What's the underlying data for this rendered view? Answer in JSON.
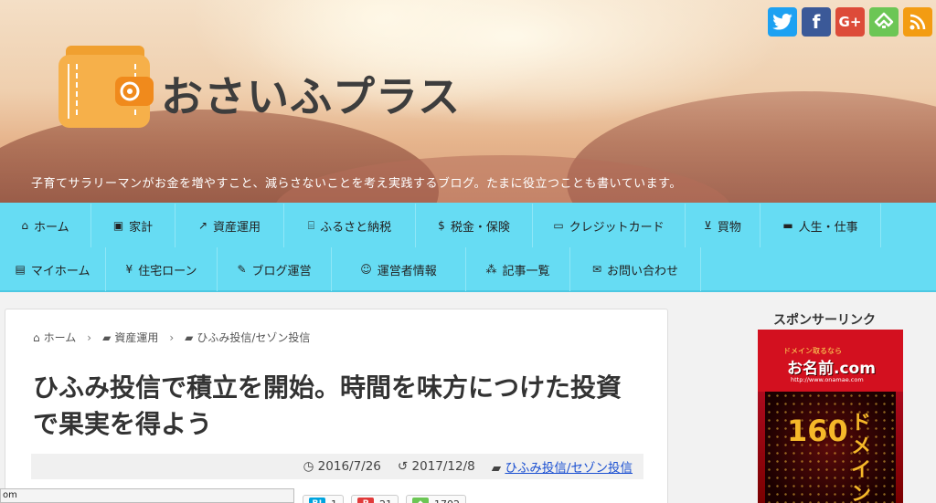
{
  "site": {
    "title": "おさいふプラス",
    "tagline": "子育てサラリーマンがお金を増やすこと、減らさないことを考え実践するブログ。たまに役立つことも書いています。"
  },
  "social": [
    {
      "name": "twitter-icon",
      "glyph": "t"
    },
    {
      "name": "facebook-icon",
      "glyph": "f"
    },
    {
      "name": "google-plus-icon",
      "glyph": "G+"
    },
    {
      "name": "feedly-icon",
      "glyph": "f"
    },
    {
      "name": "rss-icon",
      "glyph": "≋"
    }
  ],
  "nav": {
    "row1": [
      {
        "icon": "⌂",
        "icon_name": "home-icon",
        "label": "ホーム"
      },
      {
        "icon": "▣",
        "icon_name": "money-icon",
        "label": "家計"
      },
      {
        "icon": "↗",
        "icon_name": "chart-icon",
        "label": "資産運用"
      },
      {
        "icon": "⌸",
        "icon_name": "institution-icon",
        "label": "ふるさと納税"
      },
      {
        "icon": "$",
        "icon_name": "dollar-icon",
        "label": "税金・保険"
      },
      {
        "icon": "▭",
        "icon_name": "credit-card-icon",
        "label": "クレジットカード"
      },
      {
        "icon": "⊻",
        "icon_name": "cart-icon",
        "label": "買物"
      },
      {
        "icon": "▬",
        "icon_name": "briefcase-icon",
        "label": "人生・仕事"
      }
    ],
    "row2": [
      {
        "icon": "▤",
        "icon_name": "building-icon",
        "label": "マイホーム"
      },
      {
        "icon": "¥",
        "icon_name": "yen-icon",
        "label": "住宅ローン"
      },
      {
        "icon": "✎",
        "icon_name": "edit-icon",
        "label": "ブログ運営"
      },
      {
        "icon": "☺",
        "icon_name": "smile-icon",
        "label": "運営者情報"
      },
      {
        "icon": "⁂",
        "icon_name": "sitemap-icon",
        "label": "記事一覧"
      },
      {
        "icon": "✉",
        "icon_name": "mail-icon",
        "label": "お問い合わせ"
      }
    ]
  },
  "breadcrumb": {
    "home": "ホーム",
    "cat1": "資産運用",
    "cat2": "ひふみ投信/セゾン投信"
  },
  "article": {
    "title": "ひふみ投信で積立を開始。時間を味方につけた投資で果実を得よう",
    "published": "2016/7/26",
    "updated": "2017/12/8",
    "category": "ひふみ投信/セゾン投信"
  },
  "share": [
    {
      "badge": "B!",
      "count": "1",
      "color": "#00a4de"
    },
    {
      "badge": "P",
      "count": "21",
      "color": "#e13a3a"
    },
    {
      "badge": "◆",
      "count": "1702",
      "color": "#6cc655"
    }
  ],
  "statusbar": {
    "text": "om"
  },
  "sidebar": {
    "sponsor_label": "スポンサーリンク",
    "ad": {
      "small": "ドメイン取るなら",
      "brand": "お名前.com",
      "url": "http://www.onamae.com",
      "number": "160",
      "vertical": "ドメイン"
    }
  },
  "colors": {
    "nav_bg": "#66dcf3",
    "link": "#1a4fd1"
  }
}
